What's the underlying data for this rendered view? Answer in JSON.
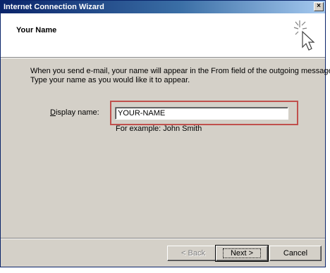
{
  "window": {
    "title": "Internet Connection Wizard",
    "close_glyph": "×"
  },
  "header": {
    "title": "Your Name",
    "icon": "wizard-cursor-sparkle-icon"
  },
  "instruction": {
    "line1": "When you send e-mail, your name will appear in the From field of the outgoing message.",
    "line2": "Type your name as you would like it to appear."
  },
  "form": {
    "display_name_label": "Display name:",
    "display_name_value": "YOUR-NAME",
    "example": "For example: John Smith"
  },
  "buttons": {
    "back_label": "< Back",
    "back_enabled": false,
    "next_label": "Next >",
    "cancel_label": "Cancel"
  },
  "colors": {
    "highlight_border": "#c0504d",
    "titlebar_start": "#0a246a",
    "face": "#d4d0c8"
  }
}
